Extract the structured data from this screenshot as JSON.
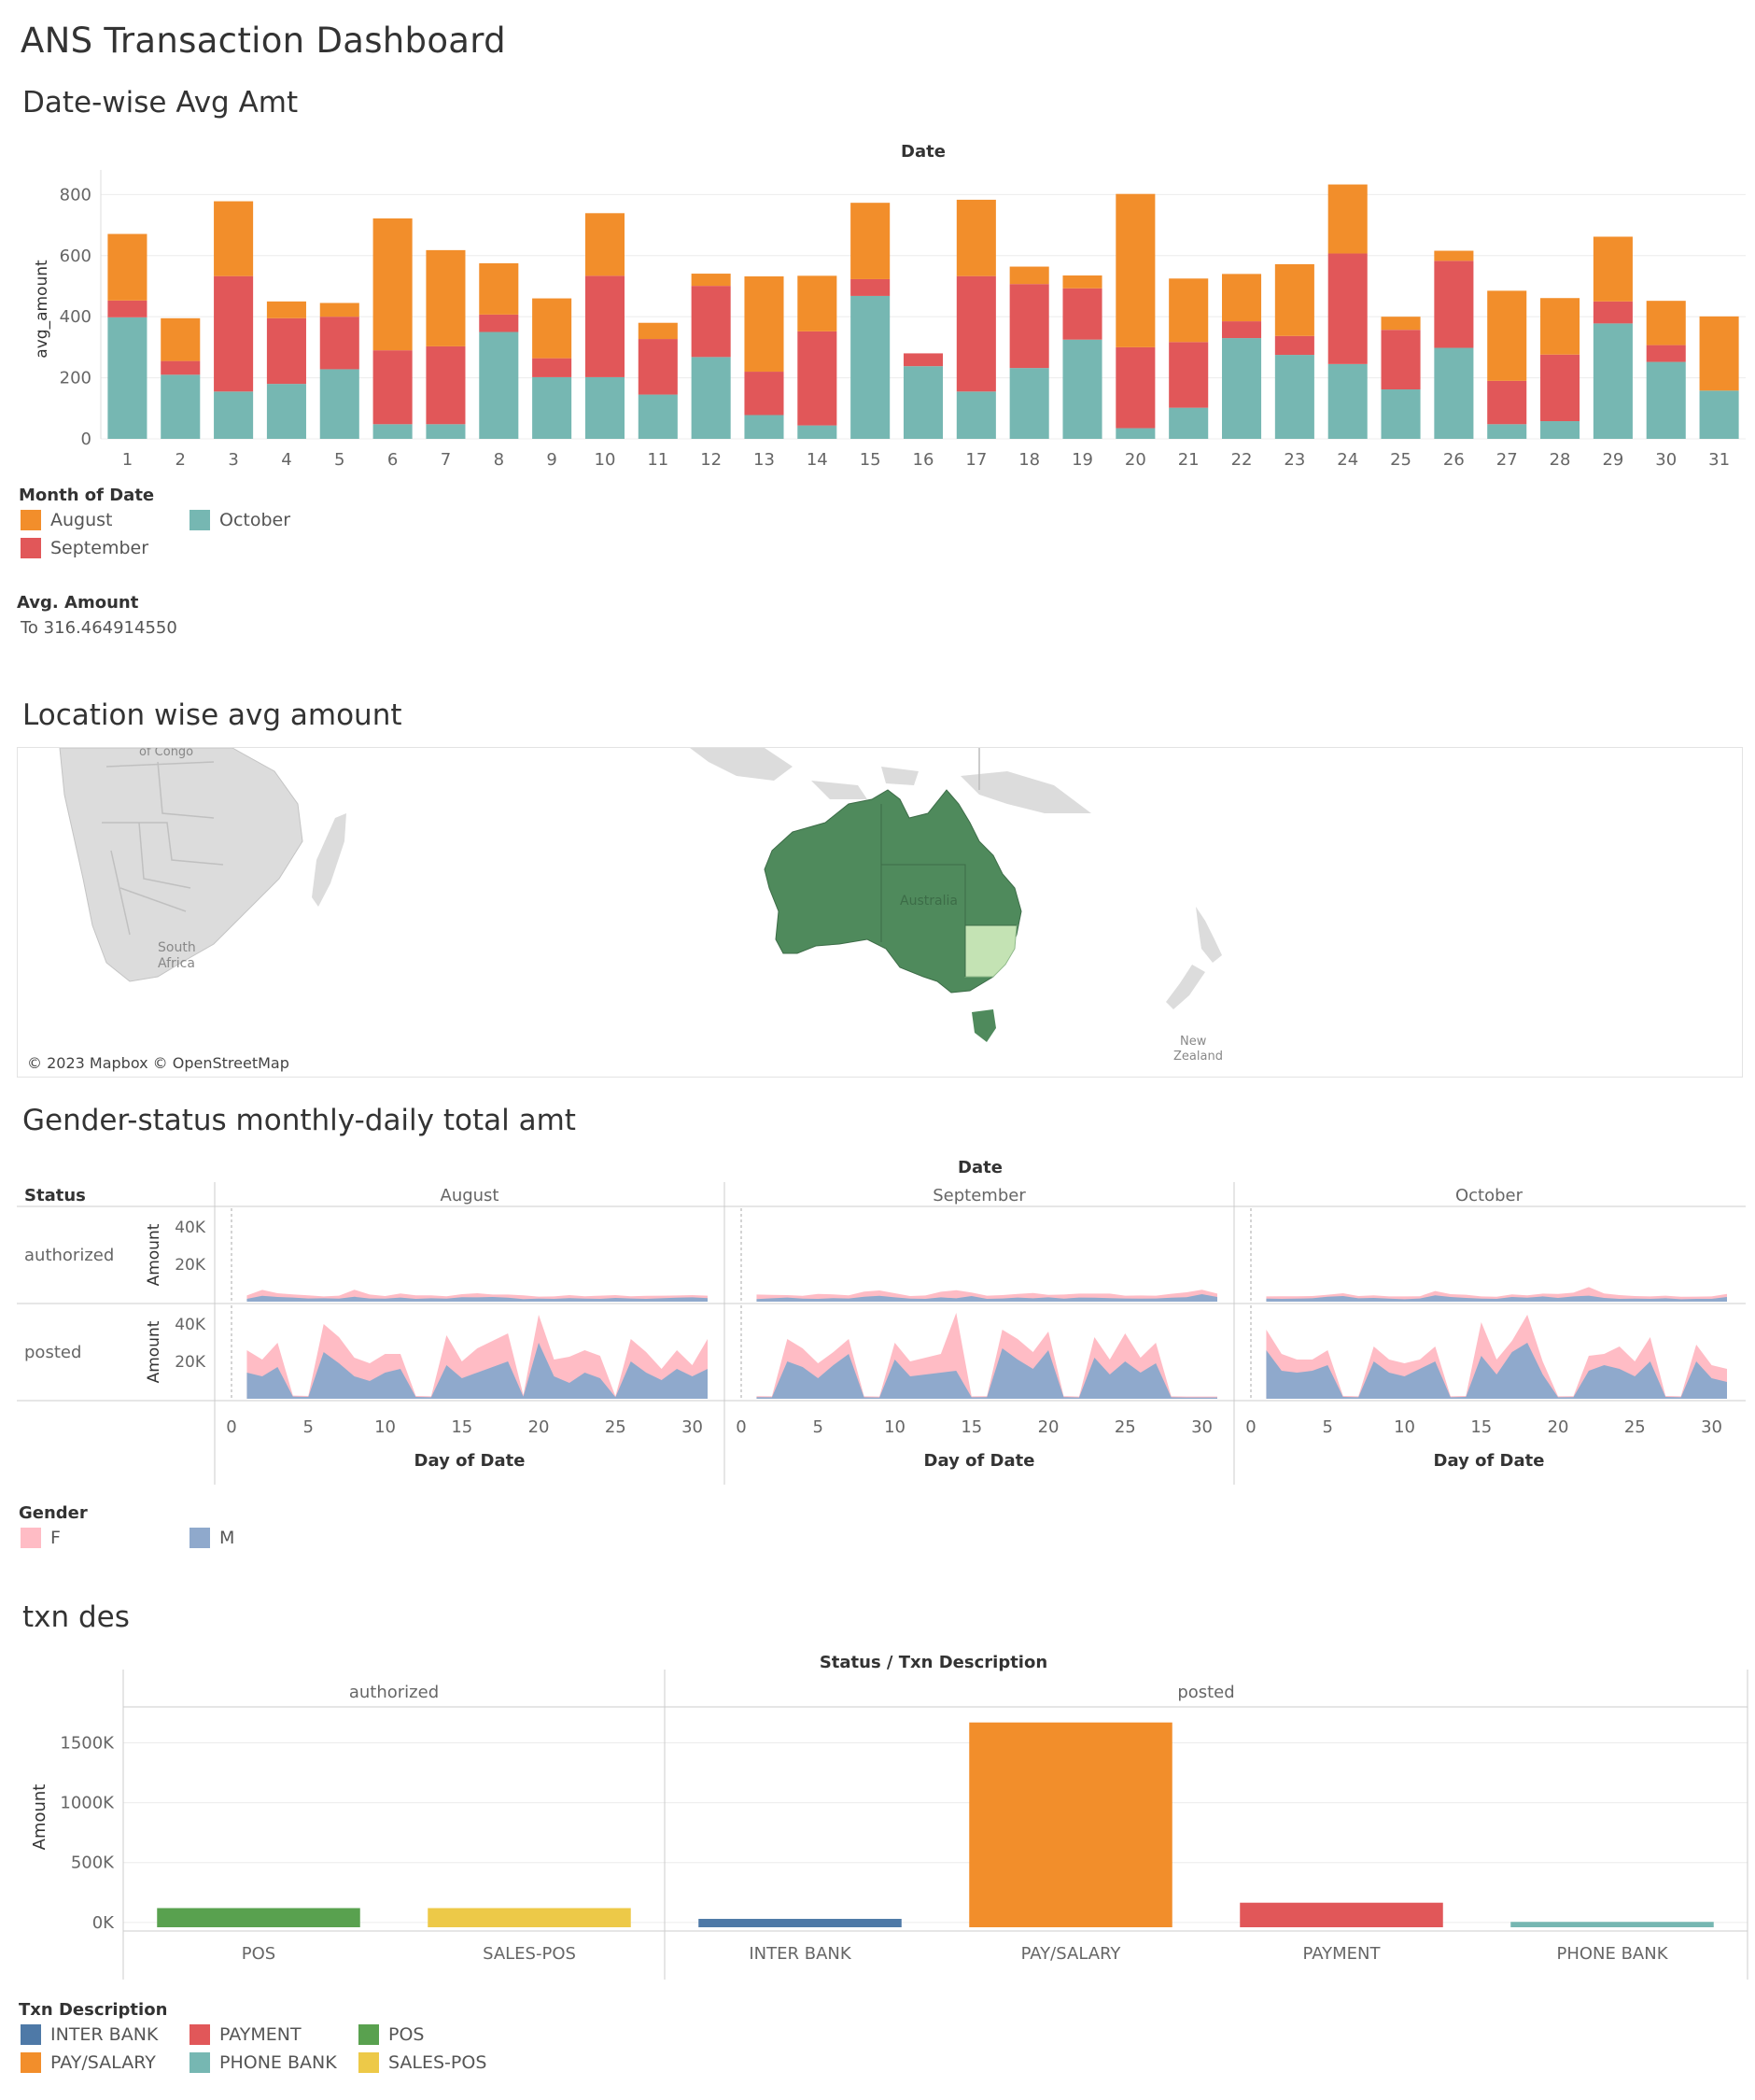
{
  "dashboard": {
    "title": "ANS Transaction Dashboard"
  },
  "sections": {
    "date_wise": "Date-wise Avg Amt",
    "location": "Location wise avg amount",
    "gender_status": "Gender-status monthly-daily total amt",
    "txn_des": "txn des"
  },
  "colors": {
    "august": "#F28E2B",
    "september": "#E15759",
    "october": "#76B7B2",
    "female": "#FFBCC5",
    "male": "#8FA9CC",
    "inter_bank": "#4E79A7",
    "pay_salary": "#F28E2B",
    "payment": "#E15759",
    "phone_bank": "#76B7B2",
    "pos": "#59A14F",
    "sales_pos": "#EDC948",
    "map_dark": "#4F8A5C",
    "map_light": "#C4E3B4"
  },
  "legends": {
    "month": {
      "title": "Month of Date",
      "items": [
        "August",
        "September",
        "October"
      ]
    },
    "avg_amount": {
      "title": "Avg. Amount",
      "text": "To 316.464914550"
    },
    "gender": {
      "title": "Gender",
      "items": [
        "F",
        "M"
      ]
    },
    "txn": {
      "title": "Txn Description",
      "items": [
        "INTER BANK",
        "PAYMENT",
        "POS",
        "PAY/SALARY",
        "PHONE BANK",
        "SALES-POS"
      ]
    }
  },
  "map": {
    "attribution": "© 2023 Mapbox © OpenStreetMap",
    "labels": {
      "congo": "of Congo",
      "south_africa": "South Africa",
      "australia": "Australia",
      "new_zealand": "New Zealand"
    }
  },
  "chart_data": [
    {
      "type": "bar",
      "stacked": true,
      "title": "Date",
      "ylabel": "avg_amount",
      "ylim": [
        0,
        850
      ],
      "yticks": [
        0,
        200,
        400,
        600,
        800
      ],
      "grid": true,
      "categories": [
        "1",
        "2",
        "3",
        "4",
        "5",
        "6",
        "7",
        "8",
        "9",
        "10",
        "11",
        "12",
        "13",
        "14",
        "15",
        "16",
        "17",
        "18",
        "19",
        "20",
        "21",
        "22",
        "23",
        "24",
        "25",
        "26",
        "27",
        "28",
        "29",
        "30",
        "31"
      ],
      "series": [
        {
          "name": "October",
          "values": [
            398,
            210,
            155,
            180,
            228,
            48,
            48,
            350,
            202,
            202,
            145,
            268,
            78,
            44,
            468,
            238,
            155,
            232,
            325,
            35,
            102,
            330,
            275,
            245,
            162,
            298,
            48,
            58,
            378,
            252,
            158
          ]
        },
        {
          "name": "September",
          "values": [
            55,
            45,
            378,
            215,
            172,
            242,
            255,
            57,
            62,
            332,
            182,
            233,
            142,
            308,
            55,
            42,
            378,
            275,
            168,
            265,
            215,
            55,
            62,
            362,
            195,
            285,
            142,
            218,
            72,
            55,
            0
          ]
        },
        {
          "name": "August",
          "values": [
            218,
            140,
            245,
            55,
            45,
            432,
            315,
            168,
            196,
            205,
            53,
            40,
            312,
            182,
            250,
            0,
            250,
            57,
            42,
            502,
            208,
            155,
            235,
            226,
            43,
            33,
            295,
            185,
            212,
            145,
            243
          ]
        }
      ]
    },
    {
      "type": "area",
      "stacked": true,
      "title": "Date",
      "ylabel": "Amount",
      "xlabel": "Day of Date",
      "row_header": "Status",
      "rows": [
        "authorized",
        "posted"
      ],
      "columns": [
        "August",
        "September",
        "October"
      ],
      "xticks": [
        0,
        5,
        10,
        15,
        20,
        25,
        30
      ],
      "yticks": [
        "20K",
        "40K"
      ],
      "ylim": [
        0,
        48000
      ],
      "x": [
        1,
        2,
        3,
        4,
        5,
        6,
        7,
        8,
        9,
        10,
        11,
        12,
        13,
        14,
        15,
        16,
        17,
        18,
        19,
        20,
        21,
        22,
        23,
        24,
        25,
        26,
        27,
        28,
        29,
        30,
        31
      ],
      "panels": [
        {
          "row": "authorized",
          "column": "August",
          "M": [
            1500,
            3100,
            2500,
            2200,
            1700,
            1800,
            1600,
            2600,
            1700,
            1600,
            2200,
            1500,
            1800,
            1600,
            2400,
            2300,
            2500,
            2100,
            1400,
            1600,
            1500,
            1900,
            1600,
            1500,
            2000,
            1700,
            1500,
            1800,
            2100,
            2300,
            1900
          ],
          "F": [
            1800,
            3200,
            2000,
            1700,
            1700,
            1000,
            1600,
            3800,
            2100,
            1400,
            2200,
            1900,
            1600,
            1300,
            1600,
            2200,
            1300,
            1700,
            2000,
            1100,
            1300,
            1600,
            1300,
            1700,
            1500,
            1200,
            1600,
            1400,
            1200,
            1200,
            1300
          ]
        },
        {
          "row": "authorized",
          "column": "September",
          "M": [
            1400,
            1800,
            2200,
            1600,
            1500,
            1900,
            1700,
            2600,
            3100,
            2300,
            1600,
            1500,
            2300,
            1800,
            3000,
            1500,
            1700,
            2200,
            1800,
            2300,
            1600,
            2200,
            2100,
            1900,
            1700,
            1600,
            1700,
            2100,
            2400,
            4000,
            2500
          ],
          "F": [
            2400,
            1800,
            1300,
            1500,
            2600,
            2000,
            1700,
            2800,
            2900,
            2200,
            1400,
            1800,
            3000,
            4300,
            1900,
            1700,
            1800,
            1900,
            2800,
            1300,
            2200,
            2100,
            2200,
            2400,
            1500,
            1700,
            1500,
            2100,
            2600,
            2400,
            1800
          ]
        },
        {
          "row": "authorized",
          "column": "October",
          "M": [
            1600,
            1500,
            1600,
            1800,
            2600,
            3000,
            1800,
            2000,
            1600,
            1300,
            1700,
            3400,
            2500,
            2000,
            1600,
            1500,
            2500,
            2100,
            2800,
            2000,
            2800,
            3200,
            2000,
            1500,
            1600,
            1500,
            1800,
            1300,
            1500,
            1500,
            2500
          ],
          "F": [
            1200,
            1400,
            1300,
            1200,
            1100,
            1500,
            1200,
            1400,
            1200,
            1500,
            1200,
            2300,
            1500,
            1700,
            1200,
            1100,
            1400,
            1300,
            1500,
            2100,
            2000,
            4600,
            2400,
            2000,
            1400,
            1300,
            1400,
            1300,
            1200,
            1300,
            1600
          ]
        },
        {
          "row": "posted",
          "column": "August",
          "M": [
            14000,
            12000,
            17000,
            1200,
            1000,
            25000,
            19000,
            12000,
            9500,
            14000,
            16000,
            1000,
            800,
            18000,
            11000,
            14000,
            17000,
            20000,
            1200,
            30000,
            12000,
            8500,
            14000,
            11000,
            900,
            20000,
            14000,
            10000,
            16000,
            12000,
            16000
          ],
          "F": [
            12000,
            9000,
            13000,
            500,
            500,
            15000,
            14000,
            10000,
            9500,
            10000,
            8000,
            500,
            500,
            16000,
            9000,
            13000,
            14000,
            15000,
            800,
            15000,
            9000,
            14000,
            12000,
            12000,
            500,
            12000,
            11000,
            6000,
            10000,
            6000,
            16000
          ]
        },
        {
          "row": "posted",
          "column": "September",
          "M": [
            900,
            800,
            20000,
            17000,
            11000,
            18000,
            24000,
            800,
            700,
            21000,
            12000,
            13000,
            14000,
            15000,
            800,
            900,
            27000,
            21000,
            16000,
            26000,
            900,
            700,
            22000,
            13000,
            20000,
            14000,
            19000,
            800,
            700,
            700,
            700
          ],
          "F": [
            500,
            500,
            12000,
            10000,
            8000,
            7000,
            8000,
            500,
            500,
            9000,
            8000,
            9000,
            10000,
            31000,
            500,
            500,
            10000,
            11000,
            9000,
            10000,
            500,
            500,
            11000,
            8000,
            15000,
            8000,
            11000,
            500,
            500,
            500,
            500
          ]
        },
        {
          "row": "posted",
          "column": "October",
          "M": [
            26000,
            15000,
            14000,
            15000,
            18000,
            1000,
            800,
            20000,
            14000,
            12000,
            16000,
            20000,
            800,
            1000,
            23000,
            13000,
            25000,
            30000,
            13000,
            800,
            900,
            15000,
            18000,
            16000,
            12000,
            20000,
            1000,
            800,
            20000,
            11000,
            9000
          ],
          "F": [
            11000,
            9000,
            7000,
            6000,
            8000,
            500,
            500,
            8000,
            7000,
            7000,
            5000,
            8000,
            500,
            500,
            18000,
            8000,
            6000,
            15000,
            7000,
            500,
            500,
            8000,
            6000,
            12000,
            8000,
            13000,
            500,
            500,
            9000,
            7000,
            7000
          ]
        }
      ]
    },
    {
      "type": "bar",
      "title": "Status / Txn Description",
      "ylabel": "Amount",
      "ylim": [
        -40000,
        1800000
      ],
      "yticks": [
        "0K",
        "500K",
        "1000K",
        "1500K"
      ],
      "grid": true,
      "groups": [
        {
          "name": "authorized",
          "categories": [
            "POS",
            "SALES-POS"
          ],
          "values": [
            120000,
            120000
          ]
        },
        {
          "name": "posted",
          "categories": [
            "INTER BANK",
            "PAY/SALARY",
            "PAYMENT",
            "PHONE BANK"
          ],
          "values": [
            30000,
            1670000,
            165000,
            5000
          ]
        }
      ]
    }
  ]
}
